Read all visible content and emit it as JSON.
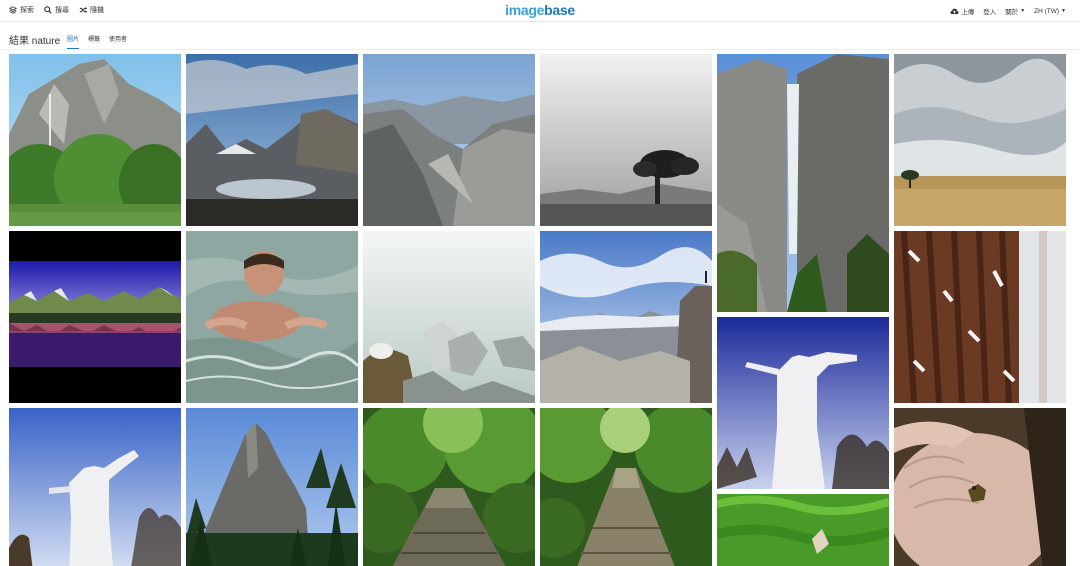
{
  "nav": {
    "explore": "探索",
    "search": "搜尋",
    "random": "隨機",
    "upload": "上傳",
    "login": "登入",
    "about": "關於",
    "language": "ZH (TW)"
  },
  "logo": {
    "part1": "image",
    "part2": "base"
  },
  "results": {
    "title": "結果 nature"
  },
  "tabs": [
    "圖片",
    "標籤",
    "使用者"
  ],
  "icons": {
    "explore": "layers-icon",
    "search": "search-icon",
    "random": "shuffle-icon",
    "upload": "cloud-upload-icon"
  },
  "colors": {
    "brand_light": "#3aa0d8",
    "brand_dark": "#1f78b4"
  }
}
